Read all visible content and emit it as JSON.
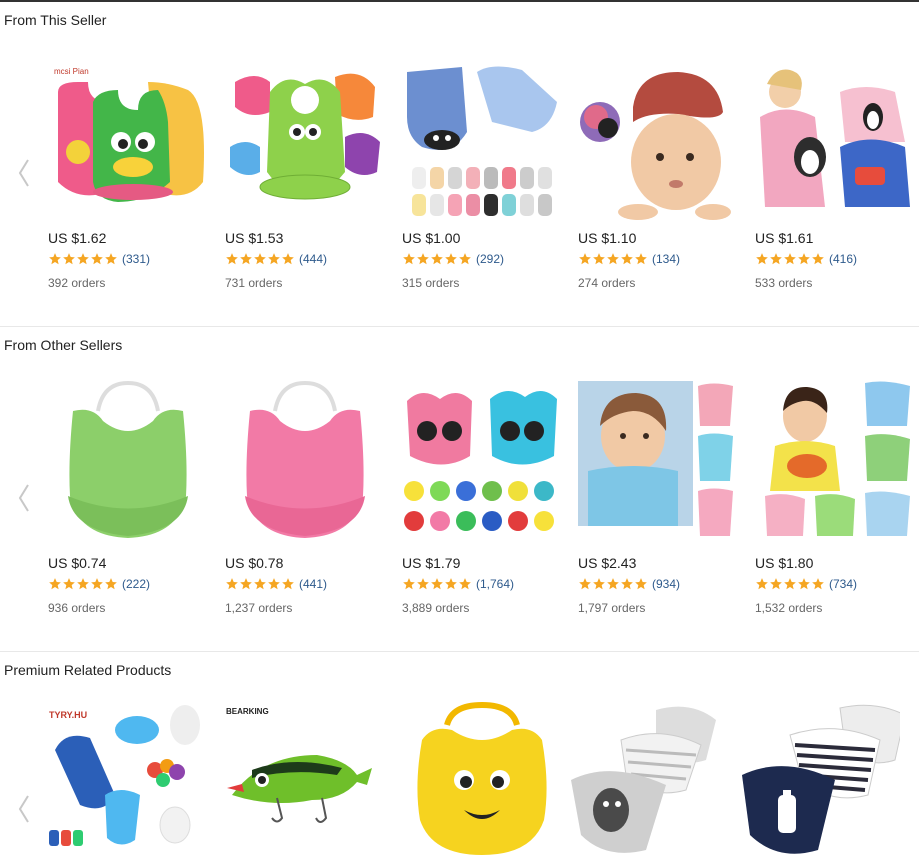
{
  "sections": [
    {
      "title": "From This Seller",
      "products": [
        {
          "price": "US $1.62",
          "reviews": "(331)",
          "orders": "392 orders",
          "rating": 5,
          "image": "colorful-bibs-frog"
        },
        {
          "price": "US $1.53",
          "reviews": "(444)",
          "orders": "731 orders",
          "rating": 5,
          "image": "green-silicone-bibs"
        },
        {
          "price": "US $1.00",
          "reviews": "(292)",
          "orders": "315 orders",
          "rating": 5,
          "image": "baby-socks"
        },
        {
          "price": "US $1.10",
          "reviews": "(134)",
          "orders": "274 orders",
          "rating": 5,
          "image": "baby-hat"
        },
        {
          "price": "US $1.61",
          "reviews": "(416)",
          "orders": "533 orders",
          "rating": 5,
          "image": "smock-bibs"
        }
      ]
    },
    {
      "title": "From Other Sellers",
      "products": [
        {
          "price": "US $0.74",
          "reviews": "(222)",
          "orders": "936 orders",
          "rating": 5,
          "image": "green-bib"
        },
        {
          "price": "US $0.78",
          "reviews": "(441)",
          "orders": "1,237 orders",
          "rating": 5,
          "image": "pink-bib"
        },
        {
          "price": "US $1.79",
          "reviews": "(1,764)",
          "orders": "3,889 orders",
          "rating": 5,
          "image": "mouse-bibs"
        },
        {
          "price": "US $2.43",
          "reviews": "(934)",
          "orders": "1,797 orders",
          "rating": 5,
          "image": "child-bib"
        },
        {
          "price": "US $1.80",
          "reviews": "(734)",
          "orders": "1,532 orders",
          "rating": 5,
          "image": "animal-bibs"
        }
      ]
    },
    {
      "title": "Premium Related Products",
      "products": [
        {
          "image": "fruit-feeder",
          "brand": "TYRY.HU"
        },
        {
          "image": "fishing-lure",
          "brand": "BEARKING"
        },
        {
          "image": "yellow-bib"
        },
        {
          "image": "bandana-bibs"
        },
        {
          "image": "bandana-bibs-milk"
        }
      ]
    }
  ],
  "colors": {
    "star": "#f5a623",
    "review_count": "#2e5a8c",
    "divider": "#e8e8e8"
  },
  "icons": {
    "carousel_prev": "chevron-left-icon",
    "rating_star": "star-icon"
  }
}
